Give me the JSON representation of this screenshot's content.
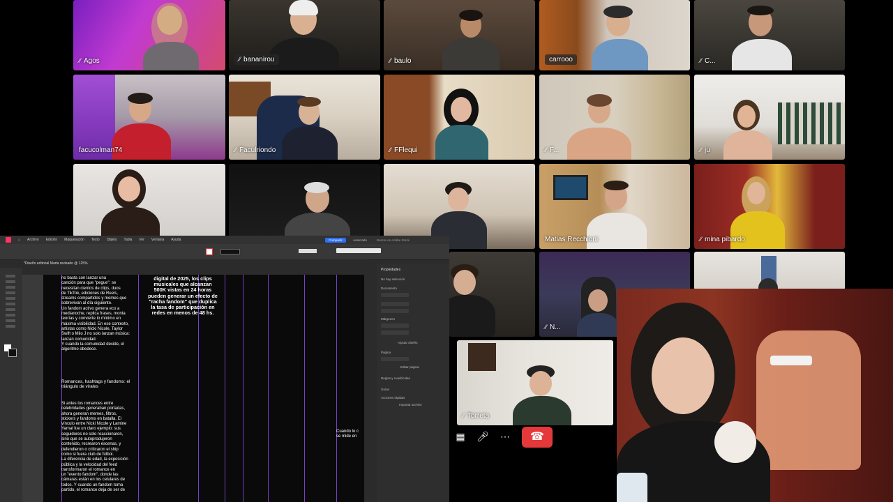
{
  "participants": [
    {
      "name": "Agos"
    },
    {
      "name": "bananirou"
    },
    {
      "name": "baulo"
    },
    {
      "name": "carrooo"
    },
    {
      "name": "C..."
    },
    {
      "name": "facucolman74"
    },
    {
      "name": "Faculriondo"
    },
    {
      "name": "FFlequi"
    },
    {
      "name": "F..."
    },
    {
      "name": "ju"
    },
    {
      "name": "Matias Recchioni"
    },
    {
      "name": "mina pibardo"
    },
    {
      "name": "N..."
    },
    {
      "name": "Torreta"
    }
  ],
  "call_controls": {
    "grid_icon": "grid-icon",
    "mic_icon": "mic-icon",
    "more_icon": "more-icon",
    "end_icon": "end-call-icon",
    "end_color": "#e5383b"
  },
  "editor": {
    "menu": [
      "Archivo",
      "Edición",
      "Maquetación",
      "Texto",
      "Objeto",
      "Tabla",
      "Ver",
      "Ventana",
      "Ayuda"
    ],
    "share_label": "Compartir",
    "workspace_label": "Avanzado",
    "search_placeholder": "Buscar en Adobe Stock",
    "doc_tab": "*Diseño editorial Marta revisado @ 125%",
    "props": {
      "title": "Propiedades",
      "none_selected": "No hay selección",
      "document": "Documento",
      "margins": "Márgenes",
      "page": "Página",
      "adjust_layout": "Ajustar diseño",
      "edit_page": "Editar página",
      "rulers": "Reglas y cuadrículas",
      "guides": "Guías",
      "quick_actions": "Acciones rápidas",
      "import_file": "Importar archivo"
    },
    "headline": "digital de 2025, los clips\nmusicales que alcanzan\n500K vistas en 24 horas\npueden generar un efecto de\n\"racha fandom\" que duplica\nla tasa de participación en\nredes en menos de 48 hs.",
    "col1": "no basta con lanzar una\ncanción para que \"pegue\": se\nnecesitan cientos de clips, duos\nde TikTok, ediciones de Reels,\nstreams compartidos y memes que\nsobrevivan al día siguiente.\nUn fandom activo genera eco a\nmedianoche, replica frases, monta\nteorías y convierte lo mínimo en\nmáxima visibilidad. En ese contexto,\nartistas como Nicki Nicole, Taylor\nSwift o Milo J no solo lanzan música:\nlanzan comunidad.\nY cuando la comunidad decide, el\nalgoritmo obedece.",
    "subhead": "Romances, hashtags y fandoms: el\ntriángulo de virales",
    "col2": "Si antes los romances entre\ncelebridades generaban portadas,\nahora generan memes, filtros,\nstickers y fandoms en batalla. El\nvínculo entre Nicki Nicole y Lamine\nYamal fue un claro ejemplo: sus\nseguidores no solo reaccionaron,\nsino que se autoprodujeron\ncontenido, recrearon escenas, y\ndefendieron o criticaron el ship\ncomo si fuera club de fútbol.\nLa diferencia de edad, la exposición\npública y la velocidad del feed\ntransformaron el romance en\nun \"evento fandom\", donde las\ncámaras están en los celulares de\ntodos. Y cuando un fandom toma\npartido, el romance deja de ser de",
    "side_note": "Cuando lo c\nse mide en"
  }
}
